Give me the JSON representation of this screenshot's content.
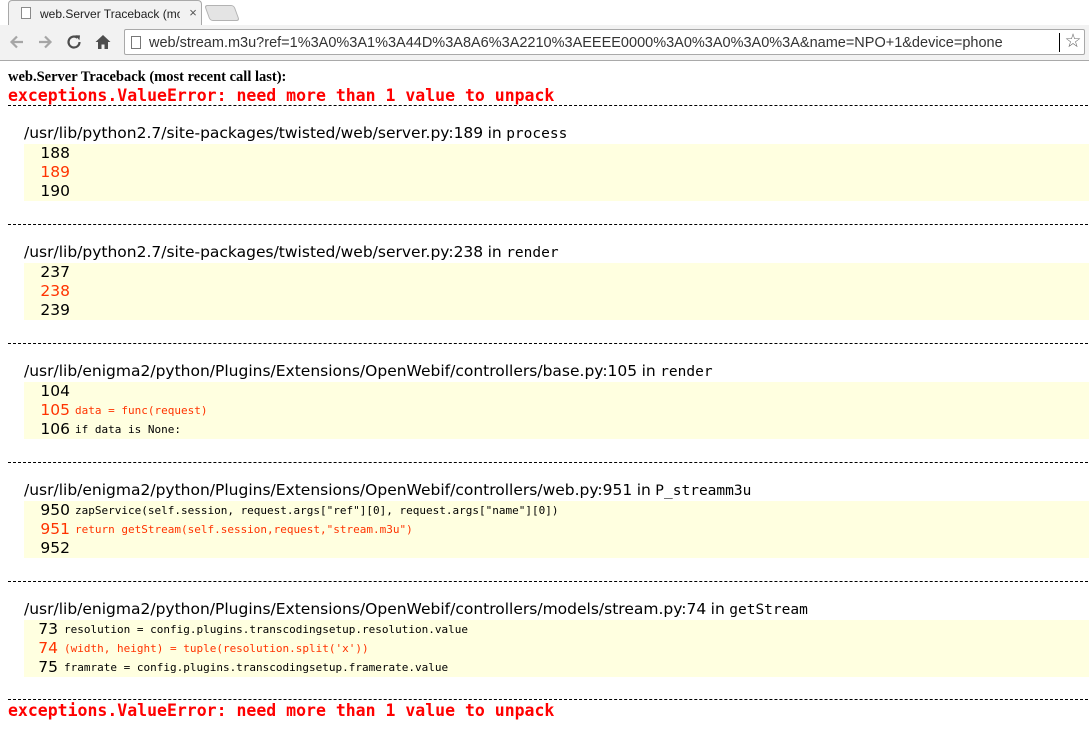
{
  "browser": {
    "tab_title": "web.Server Traceback (mo",
    "tab_close": "×",
    "url": "web/stream.m3u?ref=1%3A0%3A1%3A44D%3A8A6%3A2210%3AEEEE0000%3A0%3A0%3A0%3A&name=NPO+1&device=phone",
    "nav_icons": {
      "back": "back-arrow-icon",
      "forward": "forward-arrow-icon",
      "reload": "reload-icon",
      "home": "home-icon",
      "bookmark": "star-icon"
    }
  },
  "traceback": {
    "header": "web.Server Traceback (most recent call last):",
    "error": "exceptions.ValueError: need more than 1 value to unpack",
    "in_word": "in",
    "frames": [
      {
        "path": "/usr/lib/python2.7/site-packages/twisted/web/server.py:189",
        "function": "process",
        "lines": [
          {
            "no": "188",
            "code": ""
          },
          {
            "no": "189",
            "code": ""
          },
          {
            "no": "190",
            "code": ""
          }
        ]
      },
      {
        "path": "/usr/lib/python2.7/site-packages/twisted/web/server.py:238",
        "function": "render",
        "lines": [
          {
            "no": "237",
            "code": ""
          },
          {
            "no": "238",
            "code": ""
          },
          {
            "no": "239",
            "code": ""
          }
        ]
      },
      {
        "path": "/usr/lib/enigma2/python/Plugins/Extensions/OpenWebif/controllers/base.py:105",
        "function": "render",
        "lines": [
          {
            "no": "104",
            "code": ""
          },
          {
            "no": "105",
            "code": "data = func(request)"
          },
          {
            "no": "106",
            "code": "if data is None:"
          }
        ]
      },
      {
        "path": "/usr/lib/enigma2/python/Plugins/Extensions/OpenWebif/controllers/web.py:951",
        "function": "P_streamm3u",
        "lines": [
          {
            "no": "950",
            "code": "zapService(self.session, request.args[\"ref\"][0], request.args[\"name\"][0])"
          },
          {
            "no": "951",
            "code": "return getStream(self.session,request,\"stream.m3u\")"
          },
          {
            "no": "952",
            "code": ""
          }
        ]
      },
      {
        "path": "/usr/lib/enigma2/python/Plugins/Extensions/OpenWebif/controllers/models/stream.py:74",
        "function": "getStream",
        "lines": [
          {
            "no": "73",
            "code": "resolution = config.plugins.transcodingsetup.resolution.value"
          },
          {
            "no": "74",
            "code": "(width, height) = tuple(resolution.split('x'))"
          },
          {
            "no": "75",
            "code": "framrate = config.plugins.transcodingsetup.framerate.value"
          }
        ]
      }
    ]
  },
  "colors": {
    "error": "#ff0000",
    "highlight_line": "#ff3300",
    "code_background": "#ffffe0"
  }
}
